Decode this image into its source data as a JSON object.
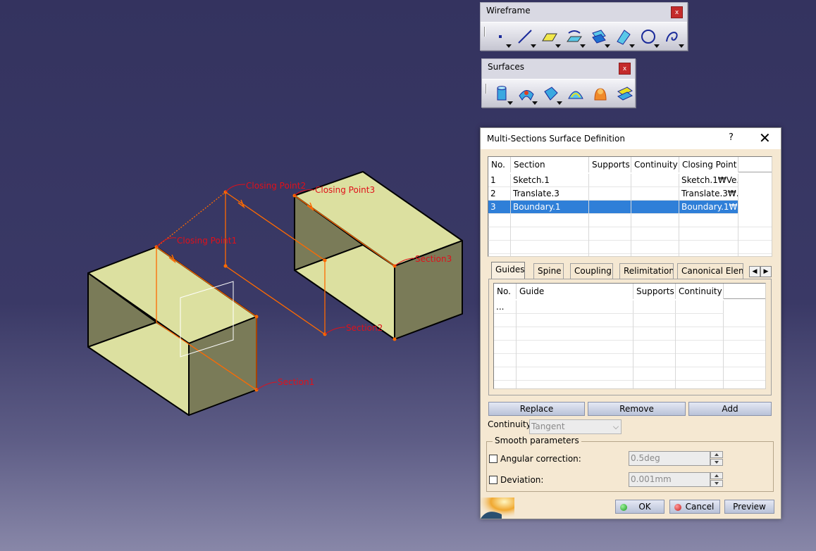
{
  "colors": {
    "annotation_red": "#e0101a",
    "selection_blue": "#2f7fd8",
    "dialog_bg": "#f5e8d2",
    "wire_orange": "#ff6a00"
  },
  "viewport": {
    "annotations": {
      "closing_point_1": "Closing Point1",
      "closing_point_2": "Closing Point2",
      "closing_point_3": "Closing Point3",
      "section_1": "Section1",
      "section_2": "Section2",
      "section_3": "Section3"
    }
  },
  "toolbars": {
    "wireframe": {
      "title": "Wireframe",
      "close": "x",
      "tools": [
        "point-icon",
        "line-icon",
        "plane-icon",
        "projection-icon",
        "offset-icon",
        "curve-icon",
        "circle-icon",
        "spline-icon"
      ]
    },
    "surfaces": {
      "title": "Surfaces",
      "close": "x",
      "tools": [
        "extrude-icon",
        "sweep-icon",
        "fill-icon",
        "multi-sections-icon",
        "blend-icon",
        "offset-surface-icon"
      ]
    }
  },
  "dialog": {
    "title": "Multi-Sections Surface Definition",
    "help": "?",
    "close": "✕",
    "sections_table": {
      "columns": [
        "No.",
        "Section",
        "Supports",
        "Continuity",
        "Closing Point"
      ],
      "rows": [
        {
          "no": "1",
          "section": "Sketch.1",
          "supports": "",
          "continuity": "",
          "closing_point": "Sketch.1₩Ve..."
        },
        {
          "no": "2",
          "section": "Translate.3",
          "supports": "",
          "continuity": "",
          "closing_point": "Translate.3₩..."
        },
        {
          "no": "3",
          "section": "Boundary.1",
          "supports": "",
          "continuity": "",
          "closing_point": "Boundary.1₩..."
        }
      ],
      "selected_row": 3
    },
    "tabs": [
      "Guides",
      "Spine",
      "Coupling",
      "Relimitation",
      "Canonical Eleme"
    ],
    "active_tab": "Guides",
    "tab_scroll": {
      "left": "◀",
      "right": "▶"
    },
    "guides_table": {
      "columns": [
        "No.",
        "Guide",
        "Supports",
        "Continuity"
      ],
      "rows": [
        {
          "no": "...",
          "guide": "",
          "supports": "",
          "continuity": ""
        }
      ]
    },
    "buttons": {
      "replace": "Replace",
      "remove": "Remove",
      "add": "Add",
      "ok": "OK",
      "cancel": "Cancel",
      "preview": "Preview"
    },
    "continuity": {
      "label": "Continuity:",
      "value": "Tangent"
    },
    "smooth": {
      "group_label": "Smooth parameters",
      "angular_label": "Angular correction:",
      "angular_value": "0.5deg",
      "angular_checked": false,
      "deviation_label": "Deviation:",
      "deviation_value": "0.001mm",
      "deviation_checked": false
    }
  }
}
